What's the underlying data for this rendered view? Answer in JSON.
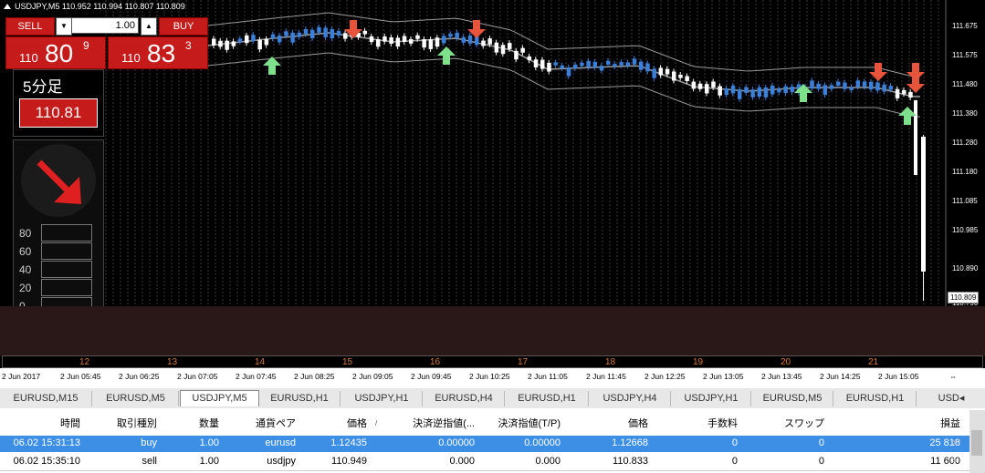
{
  "chart": {
    "title": "USDJPY,M5  110.952 110.994 110.807 110.809",
    "current_price": "110.809",
    "hidden_price": "110.790",
    "price_levels": [
      "111.675",
      "111.575",
      "111.480",
      "111.380",
      "111.280",
      "111.180",
      "111.085",
      "110.985",
      "110.890"
    ]
  },
  "trade_panel": {
    "sell_label": "SELL",
    "buy_label": "BUY",
    "lot_value": "1.00",
    "lot_down": "▼",
    "lot_up": "▲",
    "sell_price_prefix": "110",
    "sell_price_main": "80",
    "sell_price_sup": "9",
    "buy_price_prefix": "110",
    "buy_price_main": "83",
    "buy_price_sup": "3"
  },
  "info_panel": {
    "timeframe": "5分足",
    "price": "110.81"
  },
  "signal_panel": {
    "gauge_labels": [
      "80",
      "60",
      "40",
      "20",
      "0"
    ],
    "gauge_level_percent": 10
  },
  "scroll_strip": {
    "numbers": [
      "12",
      "13",
      "14",
      "15",
      "16",
      "17",
      "18",
      "19",
      "20",
      "21"
    ]
  },
  "time_axis": {
    "labels": [
      "2 Jun 2017",
      "2 Jun 05:45",
      "2 Jun 06:25",
      "2 Jun 07:05",
      "2 Jun 07:45",
      "2 Jun 08:25",
      "2 Jun 09:05",
      "2 Jun 09:45",
      "2 Jun 10:25",
      "2 Jun 11:05",
      "2 Jun 11:45",
      "2 Jun 12:25",
      "2 Jun 13:05",
      "2 Jun 13:45",
      "2 Jun 14:25",
      "2 Jun 15:05"
    ],
    "scroll_icon": "⇔"
  },
  "tabs": [
    {
      "label": "EURUSD,M15"
    },
    {
      "label": "EURUSD,M5"
    },
    {
      "label": "USDJPY,M5",
      "active": true
    },
    {
      "label": "EURUSD,H1"
    },
    {
      "label": "USDJPY,H1"
    },
    {
      "label": "EURUSD,H4"
    },
    {
      "label": "EURUSD,H1"
    },
    {
      "label": "USDJPY,H4"
    },
    {
      "label": "USDJPY,H1"
    },
    {
      "label": "EURUSD,M5"
    },
    {
      "label": "EURUSD,H1"
    },
    {
      "label": "USD◂"
    }
  ],
  "table": {
    "headers": [
      "時間",
      "取引種別",
      "数量",
      "通貨ペア",
      "価格",
      "決済逆指値(...",
      "決済指値(T/P)",
      "価格",
      "手数料",
      "スワップ",
      "損益"
    ],
    "sort_icon": "/",
    "rows": [
      [
        "06.02 15:31:13",
        "buy",
        "1.00",
        "eurusd",
        "1.12435",
        "0.00000",
        "0.00000",
        "1.12668",
        "0",
        "0",
        "25 818"
      ],
      [
        "06.02 15:35:10",
        "sell",
        "1.00",
        "usdjpy",
        "110.949",
        "0.000",
        "0.000",
        "110.833",
        "0",
        "0",
        "11 600"
      ]
    ],
    "close_icon": "×"
  },
  "colors": {
    "chart_bg": "#000000",
    "bull_candle": "#3a7fd9",
    "bear_candle": "#ffffff",
    "sell_arrow": "#e8533c",
    "buy_arrow": "#7ee08a",
    "panel_red": "#c61b1b",
    "selected_row": "#3d8fe6"
  }
}
